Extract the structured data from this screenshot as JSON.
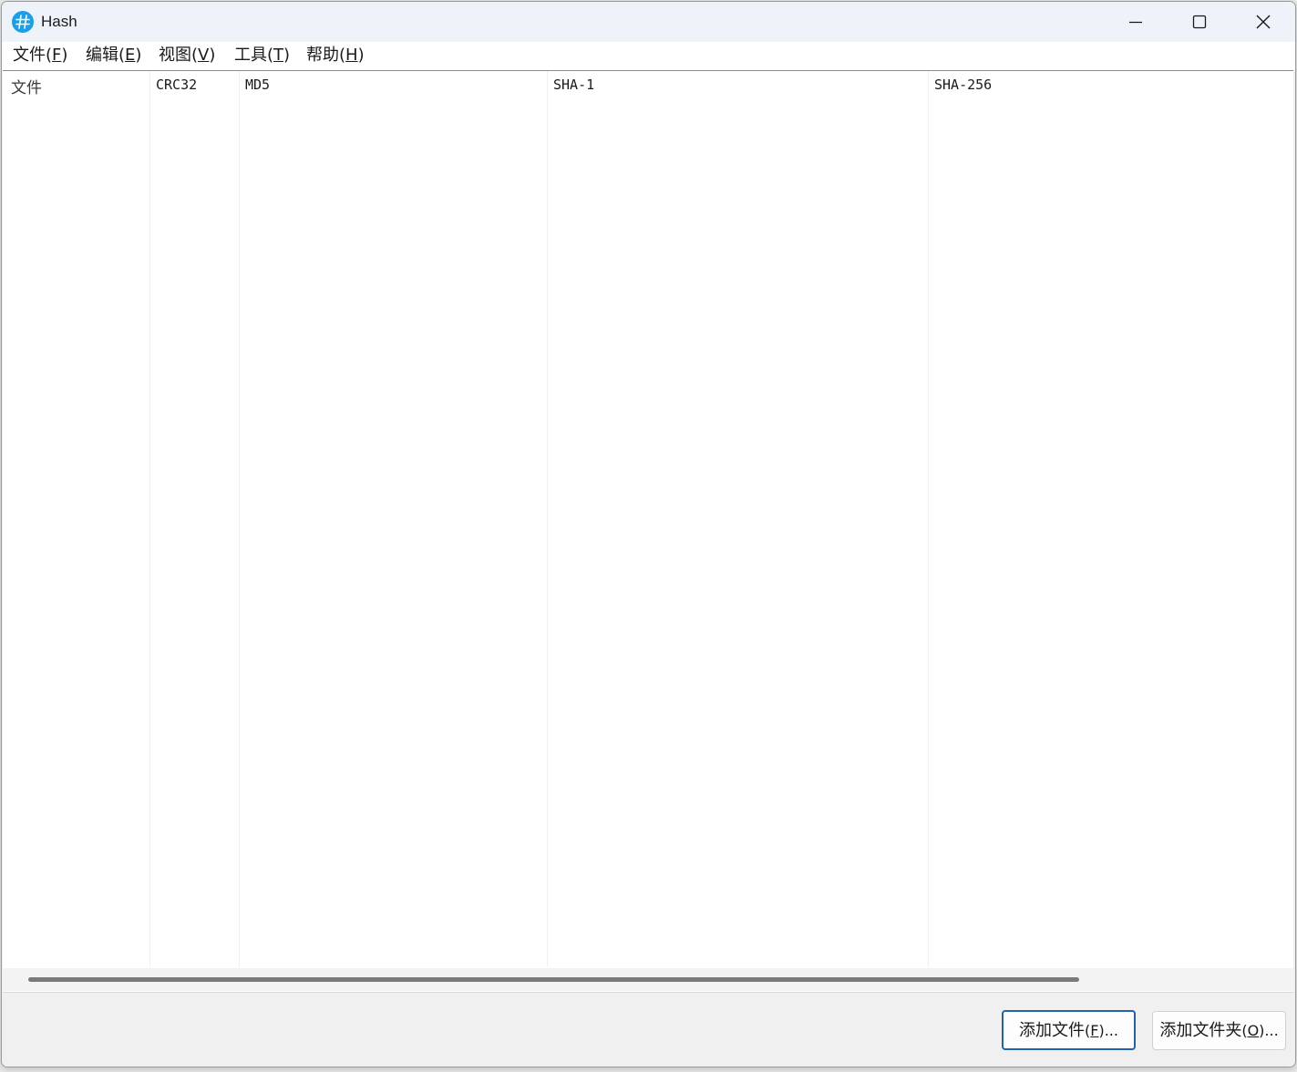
{
  "window": {
    "title": "Hash",
    "app_icon": "hash-icon",
    "controls": {
      "minimize_icon": "minimize-icon",
      "maximize_icon": "maximize-icon",
      "close_icon": "close-icon"
    }
  },
  "menubar": {
    "items": [
      {
        "label": "文件(",
        "accel": "F",
        "suffix": ")"
      },
      {
        "label": "编辑(",
        "accel": "E",
        "suffix": ")"
      },
      {
        "label": "视图(",
        "accel": "V",
        "suffix": ")"
      },
      {
        "label": "工具(",
        "accel": "T",
        "suffix": ")"
      },
      {
        "label": "帮助(",
        "accel": "H",
        "suffix": ")"
      }
    ]
  },
  "list": {
    "columns": [
      "文件",
      "CRC32",
      "MD5",
      "SHA-1",
      "SHA-256"
    ],
    "rows": []
  },
  "buttons": {
    "add_file": {
      "label": "添加文件",
      "accel_prefix": "(",
      "accel": "F",
      "accel_suffix": ")..."
    },
    "add_folder": {
      "label": "添加文件夹",
      "accel_prefix": "(",
      "accel": "O",
      "accel_suffix": ")..."
    }
  },
  "colors": {
    "accent": "#1aa0e8",
    "default_button_border": "#1e62b0",
    "titlebar_bg": "#eef2f9"
  }
}
